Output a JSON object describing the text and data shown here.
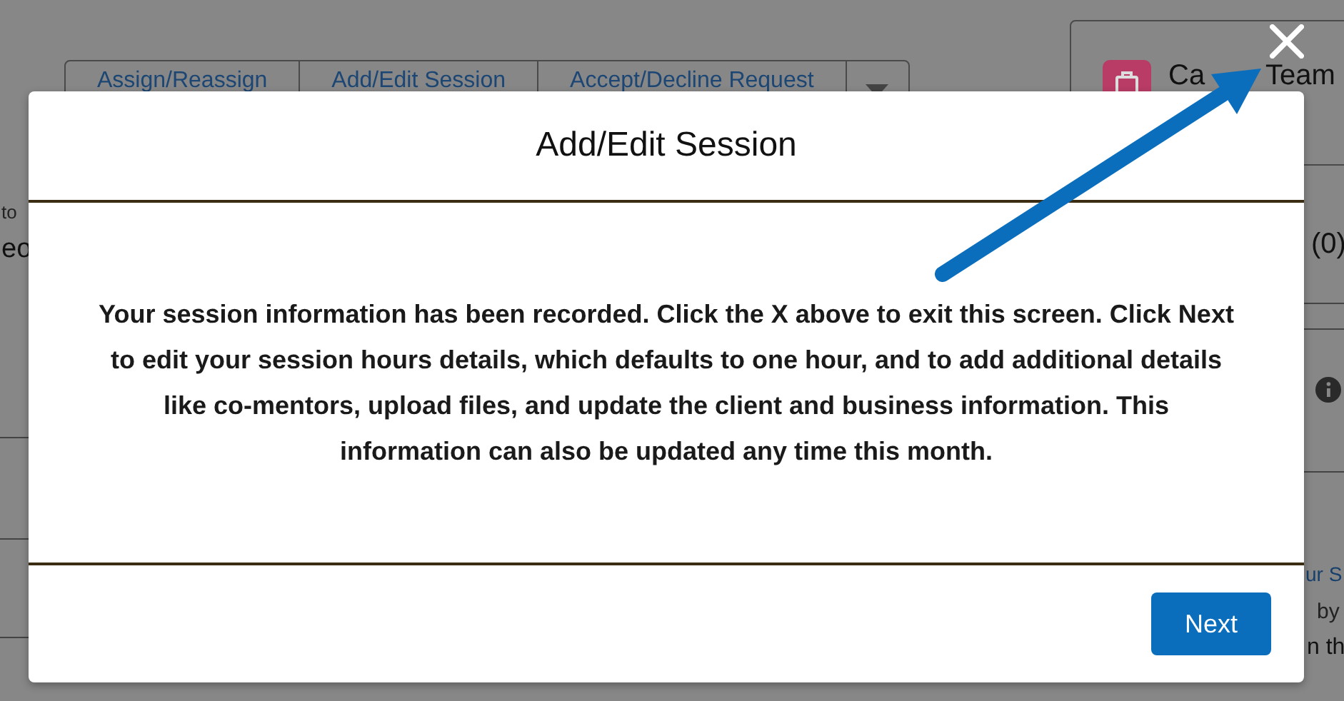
{
  "background": {
    "tabs": [
      {
        "label": "Assign/Reassign"
      },
      {
        "label": "Add/Edit Session"
      },
      {
        "label": "Accept/Decline Request"
      }
    ],
    "card_title": [
      "Ca",
      "Team"
    ],
    "left_texts": [
      "to",
      "eo"
    ],
    "right_count": "(0)",
    "right_link": "ur S",
    "right_texts": [
      "by",
      "n th"
    ]
  },
  "modal": {
    "title": "Add/Edit Session",
    "message": "Your session information has been recorded. Click the X above to exit this screen. Click Next to edit your session hours details, which defaults to one hour, and to add additional details like co-mentors, upload files, and update the client and business information. This information can also be updated any time this month.",
    "next_button": "Next"
  }
}
